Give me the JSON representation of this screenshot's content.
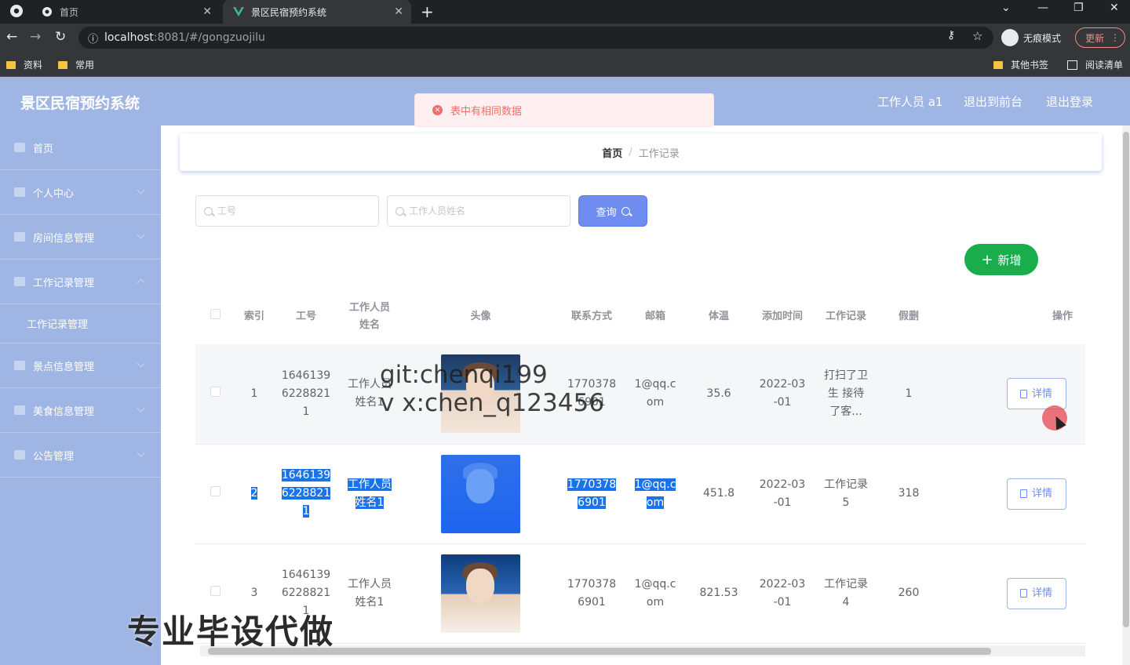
{
  "browser": {
    "tabs": [
      {
        "title": "首页"
      },
      {
        "title": "景区民宿预约系统"
      }
    ],
    "url_host": "localhost",
    "url_rest": ":8081/#/gongzuojilu",
    "incognito_label": "无痕模式",
    "update_label": "更新",
    "bookmarks": [
      {
        "label": "资料"
      },
      {
        "label": "常用"
      },
      {
        "label": "其他书签"
      },
      {
        "label": "阅读清单"
      }
    ]
  },
  "app": {
    "title": "景区民宿预约系统",
    "header_links": [
      "工作人员 a1",
      "退出到前台",
      "退出登录"
    ]
  },
  "toast": {
    "message": "表中有相同数据"
  },
  "sidebar": {
    "items": [
      {
        "label": "首页"
      },
      {
        "label": "个人中心"
      },
      {
        "label": "房间信息管理"
      },
      {
        "label": "工作记录管理"
      },
      {
        "label": "工作记录管理"
      },
      {
        "label": "景点信息管理"
      },
      {
        "label": "美食信息管理"
      },
      {
        "label": "公告管理"
      }
    ]
  },
  "breadcrumb": {
    "home": "首页",
    "separator": "/",
    "current": "工作记录"
  },
  "search": {
    "gonghao_placeholder": "工号",
    "name_placeholder": "工作人员姓名",
    "query_label": "查询",
    "add_label": "新增"
  },
  "table": {
    "headers": [
      "索引",
      "工号",
      "工作人员\n姓名",
      "头像",
      "联系方式",
      "邮箱",
      "体温",
      "添加时间",
      "工作记录",
      "假删",
      "操作"
    ],
    "rows": [
      {
        "index": "1",
        "gonghao": "1646139\n6228821\n1",
        "name": "工作人员\n姓名1",
        "phone": "1770378\n6901",
        "email": "1@qq.c\nom",
        "temp": "35.6",
        "time": "2022-03\n-01",
        "record": "打扫了卫\n生 接待\n了客...",
        "deleted": "1",
        "action": "详情"
      },
      {
        "index": "2",
        "gonghao": "1646139\n6228821\n1",
        "name": "工作人员\n姓名1",
        "phone": "1770378\n6901",
        "email": "1@qq.c\nom",
        "temp": "451.8",
        "time": "2022-03\n-01",
        "record": "工作记录\n5",
        "deleted": "318",
        "action": "详情"
      },
      {
        "index": "3",
        "gonghao": "1646139\n6228821\n1",
        "name": "工作人员\n姓名1",
        "phone": "1770378\n6901",
        "email": "1@qq.c\nom",
        "temp": "821.53",
        "time": "2022-03\n-01",
        "record": "工作记录\n4",
        "deleted": "260",
        "action": "详情"
      }
    ]
  },
  "overlay": {
    "watermark_line1": "git:chenqi199",
    "watermark_line2": "v x:chen_q123456",
    "watermark_bottom": "专业毕设代做"
  }
}
